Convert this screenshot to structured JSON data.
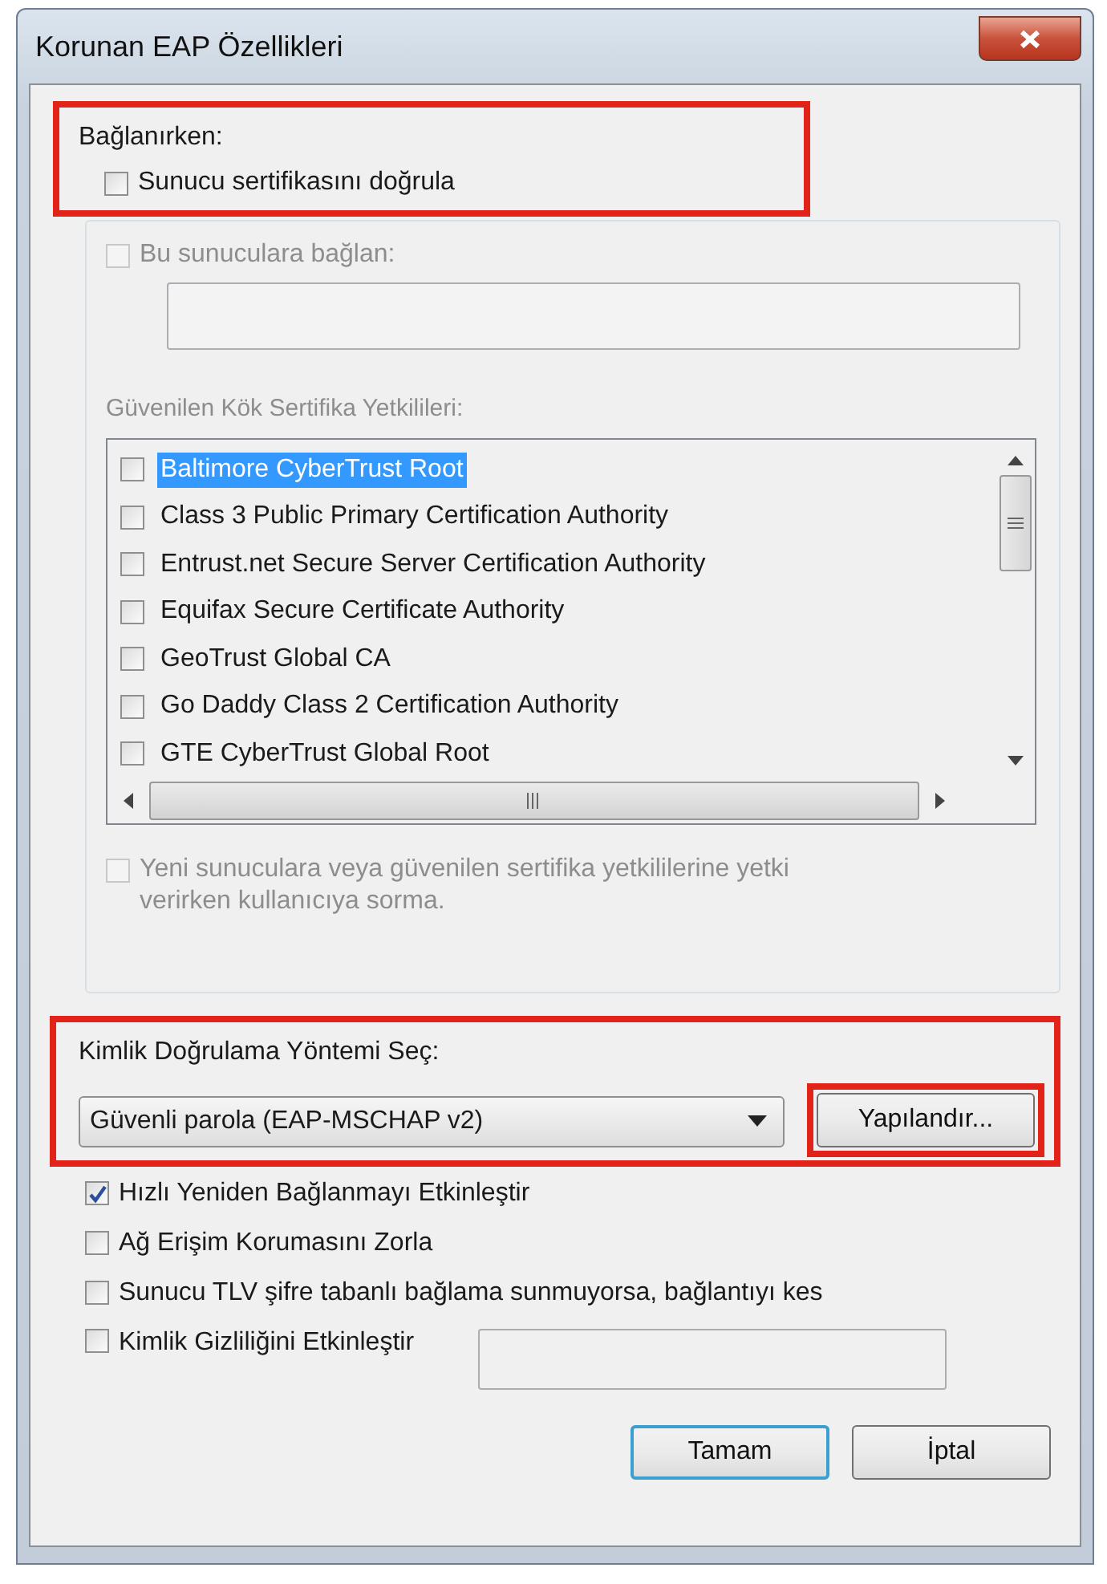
{
  "window": {
    "title": "Korunan EAP Özellikleri"
  },
  "connect_section": {
    "label": "Bağlanırken:",
    "highlighted": true,
    "verify_certificate": {
      "label": "Sunucu sertifikasını doğrula",
      "checked": false
    }
  },
  "server_group": {
    "servers_option": {
      "label": "Bu sunuculara bağlan:",
      "checked": false,
      "disabled": true
    },
    "ca_label": "Güvenilen Kök Sertifika Yetkilileri:",
    "certificates": [
      {
        "name": "Baltimore CyberTrust Root",
        "checked": false,
        "selected": true
      },
      {
        "name": "Class 3 Public Primary Certification Authority",
        "checked": false,
        "selected": false
      },
      {
        "name": "Entrust.net Secure Server Certification Authority",
        "checked": false,
        "selected": false
      },
      {
        "name": "Equifax Secure Certificate Authority",
        "checked": false,
        "selected": false
      },
      {
        "name": "GeoTrust Global CA",
        "checked": false,
        "selected": false
      },
      {
        "name": "Go Daddy Class 2 Certification Authority",
        "checked": false,
        "selected": false
      },
      {
        "name": "GTE CyberTrust Global Root",
        "checked": false,
        "selected": false
      }
    ],
    "prompt_option": {
      "label": "Yeni sunuculara veya güvenilen sertifika yetkililerine yetki verirken kullanıcıya sorma.",
      "checked": false,
      "disabled": true
    }
  },
  "auth_section": {
    "label": "Kimlik Doğrulama Yöntemi Seç:",
    "highlighted": true,
    "method": "Güvenli parola (EAP-MSCHAP v2)",
    "configure_button": {
      "label": "Yapılandır...",
      "highlighted": true
    }
  },
  "options": [
    {
      "kind": "checkbox",
      "label": "Hızlı Yeniden Bağlanmayı Etkinleştir",
      "checked": true
    },
    {
      "kind": "checkbox",
      "label": "Ağ Erişim Korumasını Zorla",
      "checked": false
    },
    {
      "kind": "checkbox",
      "label": "Sunucu TLV şifre tabanlı bağlama sunmuyorsa, bağlantıyı kes",
      "checked": false
    },
    {
      "kind": "checkbox-with-field",
      "label": "Kimlik Gizliliğini Etkinleştir",
      "checked": false
    }
  ],
  "buttons": [
    {
      "label": "Tamam",
      "default": true
    },
    {
      "label": "İptal",
      "default": false
    }
  ]
}
